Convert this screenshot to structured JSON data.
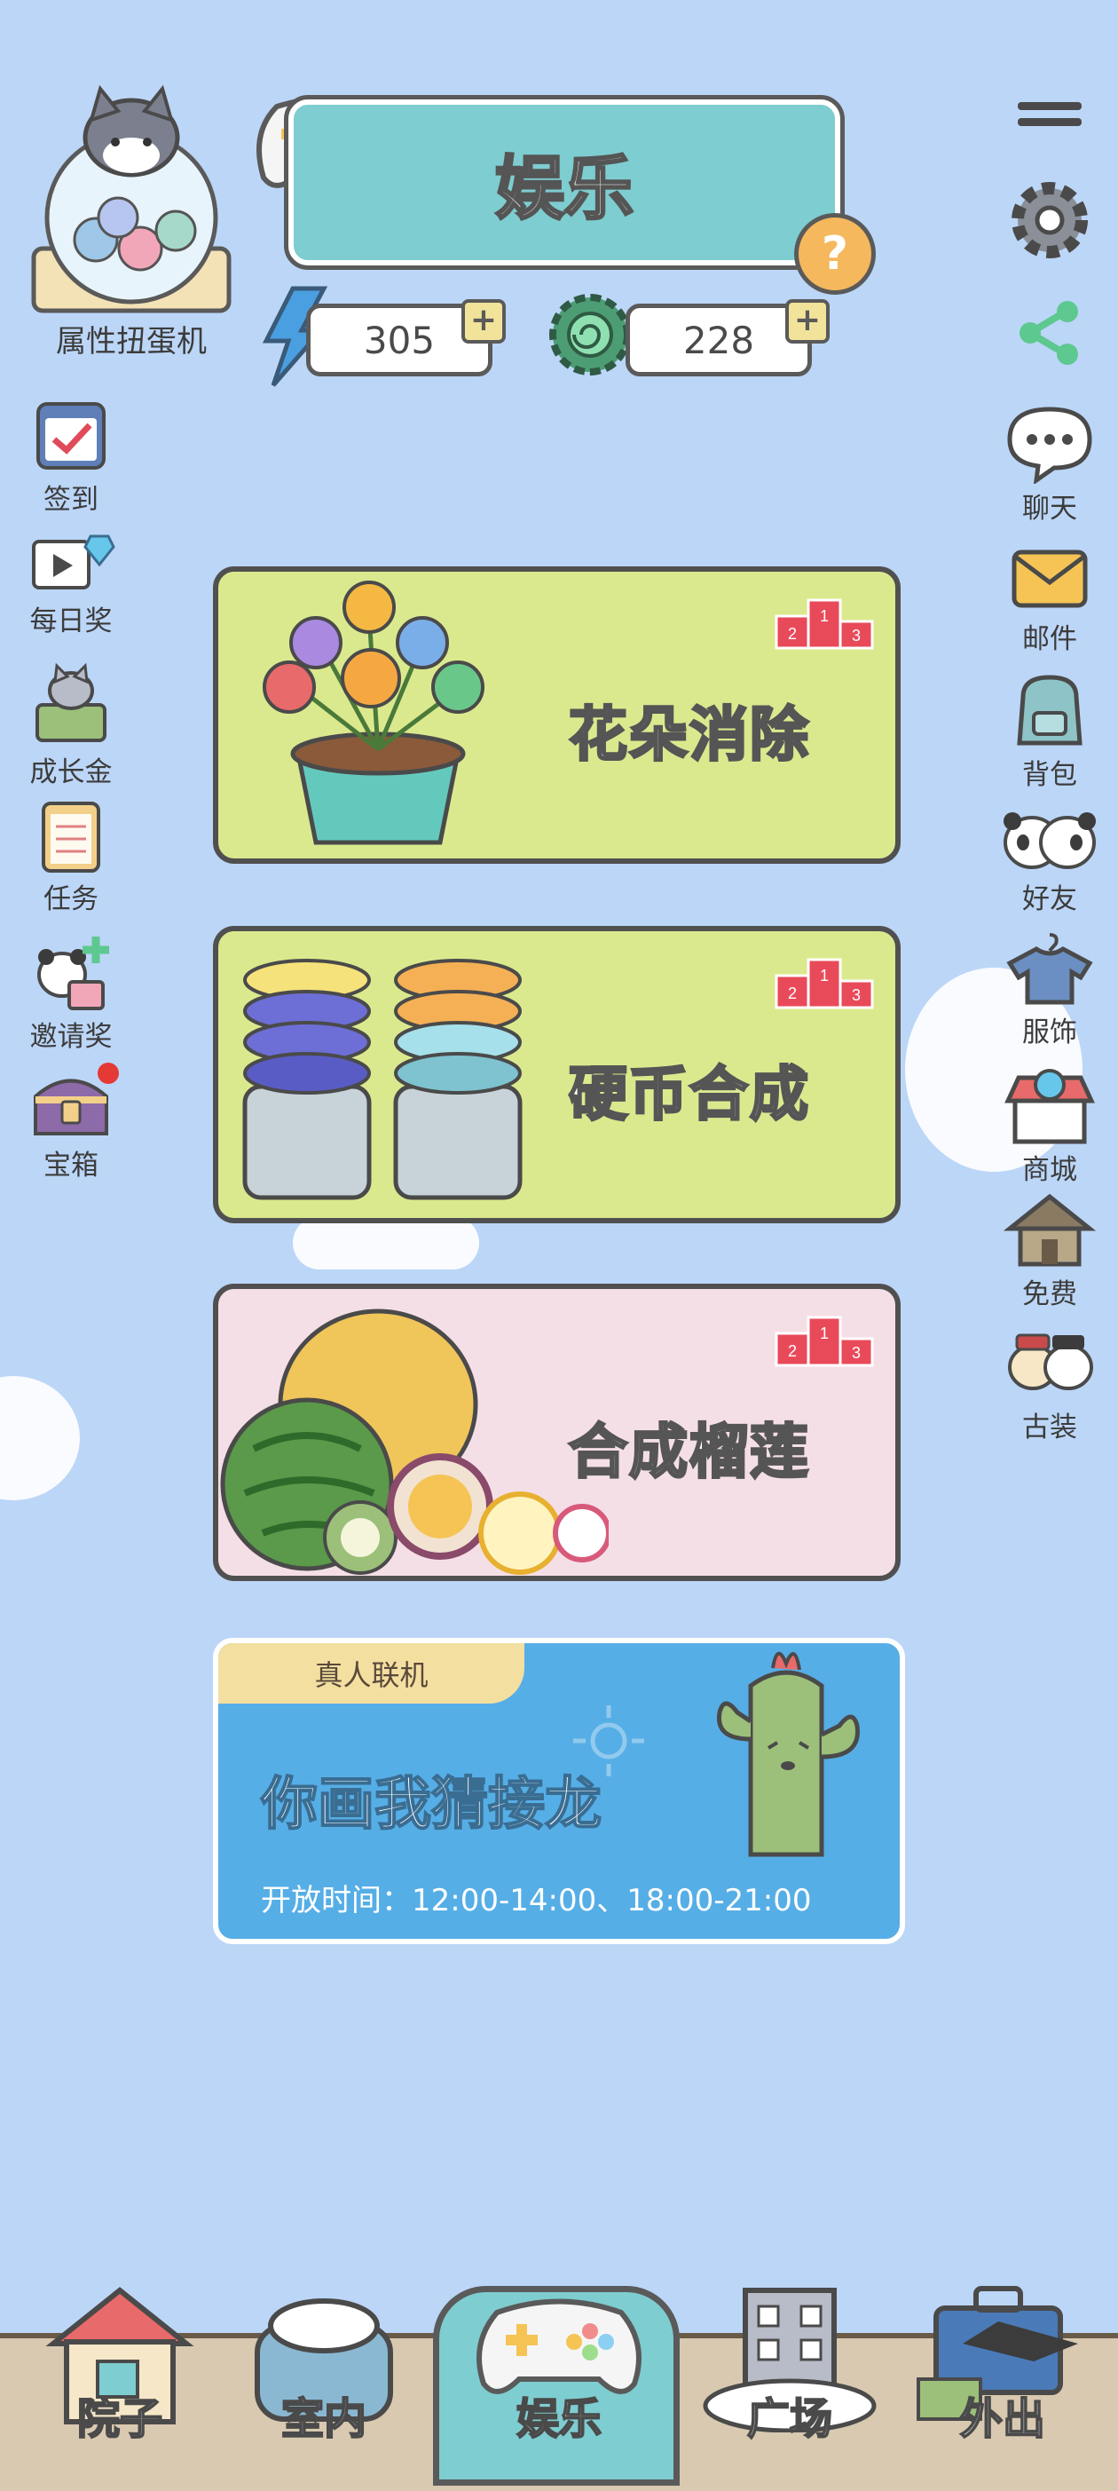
{
  "header": {
    "title": "娱乐",
    "help_icon": "question-icon",
    "gacha_label": "属性扭蛋机",
    "energy": {
      "value": "305",
      "icon": "lightning-icon",
      "plus": "+"
    },
    "gear": {
      "value": "228",
      "icon": "gear-spiral-icon",
      "plus": "+"
    }
  },
  "left_menu": [
    {
      "label": "签到",
      "icon": "calendar-check-icon"
    },
    {
      "label": "每日奖",
      "icon": "video-diamond-icon"
    },
    {
      "label": "成长金",
      "icon": "money-cat-icon"
    },
    {
      "label": "任务",
      "icon": "notepad-icon"
    },
    {
      "label": "邀请奖",
      "icon": "panda-gift-icon"
    },
    {
      "label": "宝箱",
      "icon": "treasure-chest-icon"
    }
  ],
  "right_menu": [
    {
      "label": "",
      "icon": "hamburger-menu-icon"
    },
    {
      "label": "",
      "icon": "settings-gear-icon"
    },
    {
      "label": "",
      "icon": "share-icon"
    },
    {
      "label": "聊天",
      "icon": "chat-bubble-icon"
    },
    {
      "label": "邮件",
      "icon": "mail-icon"
    },
    {
      "label": "背包",
      "icon": "backpack-icon"
    },
    {
      "label": "好友",
      "icon": "panda-friends-icon"
    },
    {
      "label": "服饰",
      "icon": "clothing-hanger-icon"
    },
    {
      "label": "商城",
      "icon": "shop-icon"
    },
    {
      "label": "免费",
      "icon": "house-icon"
    },
    {
      "label": "古装",
      "icon": "costume-cats-icon"
    }
  ],
  "games": [
    {
      "title": "花朵消除",
      "bg": "#dbe98e",
      "podium": [
        "2",
        "1",
        "3"
      ]
    },
    {
      "title": "硬币合成",
      "bg": "#dbe98e",
      "podium": [
        "2",
        "1",
        "3"
      ]
    },
    {
      "title": "合成榴莲",
      "bg": "#f5dfe6",
      "podium": [
        "2",
        "1",
        "3"
      ]
    }
  ],
  "online_game": {
    "tag": "真人联机",
    "title": "你画我猜接龙",
    "time": "开放时间：12:00-14:00、18:00-21:00"
  },
  "bottom_nav": [
    {
      "label": "院子",
      "icon": "house-yard-icon",
      "active": false
    },
    {
      "label": "室内",
      "icon": "pillow-bed-icon",
      "active": false
    },
    {
      "label": "娱乐",
      "icon": "gamepad-icon",
      "active": true
    },
    {
      "label": "广场",
      "icon": "building-icon",
      "active": false
    },
    {
      "label": "外出",
      "icon": "suitcase-graduation-icon",
      "active": false
    }
  ]
}
